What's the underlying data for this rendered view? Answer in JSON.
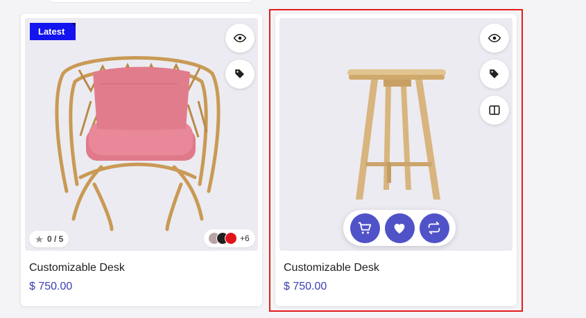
{
  "products": [
    {
      "title": "Customizable Desk",
      "price": "$ 750.00",
      "badge": "Latest",
      "rating": "0 / 5",
      "more_colors": "+6",
      "swatches": [
        "#b9a4a4",
        "#202020",
        "#e0141b"
      ],
      "icons": [
        "eye-icon",
        "tag-icon"
      ]
    },
    {
      "title": "Customizable Desk",
      "price": "$ 750.00",
      "icons": [
        "eye-icon",
        "tag-icon",
        "compare-icon"
      ],
      "actions": [
        "cart-icon",
        "heart-icon",
        "repeat-icon"
      ]
    }
  ],
  "colors": {
    "accent": "#5052c8",
    "badge": "#1414ee",
    "price": "#3a3fb0",
    "highlight": "#e21b1b"
  }
}
